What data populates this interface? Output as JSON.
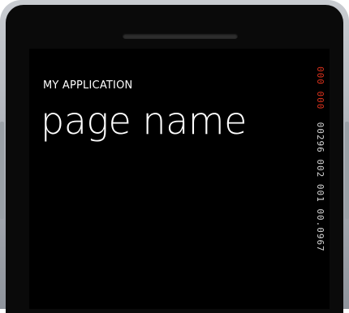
{
  "app": {
    "title": "MY APPLICATION",
    "page_name": "page name"
  },
  "frame_rate_counter": {
    "red_segment": "000 000",
    "white_segment": "00296 002 001 00.0967",
    "colors": {
      "red": "#e0331d",
      "white": "#d8d8d8"
    }
  }
}
